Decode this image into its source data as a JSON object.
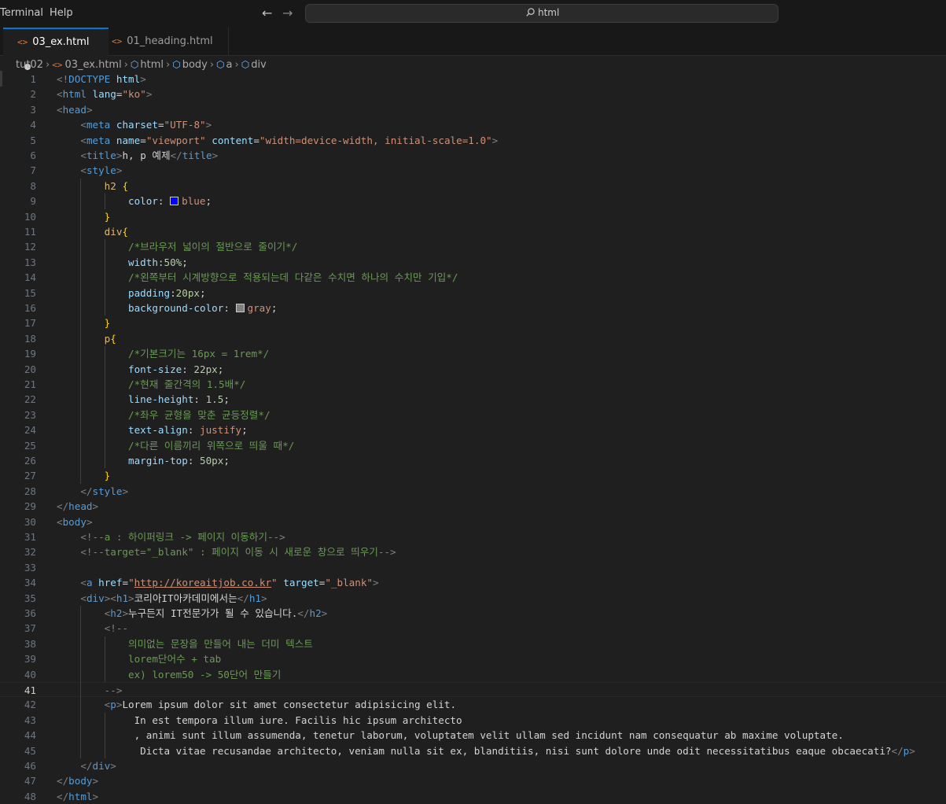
{
  "menu": {
    "terminal": "Terminal",
    "help": "Help"
  },
  "search": {
    "text": "html"
  },
  "tabs": [
    {
      "label": "03_ex.html",
      "active": true,
      "dirty": true
    },
    {
      "label": "01_heading.html",
      "active": false
    }
  ],
  "breadcrumb": [
    "tut02",
    "03_ex.html",
    "html",
    "body",
    "a",
    "div"
  ],
  "colors": {
    "tag": "#569cd6",
    "attr": "#9cdcfe",
    "string": "#ce9178",
    "comment": "#6a9955",
    "accent": "#0078d4"
  },
  "current_line": 41,
  "lines": [
    "<!DOCTYPE html>",
    "<html lang=\"ko\">",
    "<head>",
    "    <meta charset=\"UTF-8\">",
    "    <meta name=\"viewport\" content=\"width=device-width, initial-scale=1.0\">",
    "    <title>h, p 예제</title>",
    "    <style>",
    "        h2 {",
    "            color: blue;",
    "        }",
    "        div{",
    "            /*브라우저 넓이의 절반으로 줄이기*/",
    "            width:50%;",
    "            /*왼쪽부터 시계방향으로 적용되는데 다같은 수치면 하나의 수치만 기입*/",
    "            padding:20px;",
    "            background-color: gray;",
    "        }",
    "        p{",
    "            /*기본크기는 16px = 1rem*/",
    "            font-size: 22px;",
    "            /*현재 줄간격의 1.5배*/",
    "            line-height: 1.5;",
    "            /*좌우 균형을 맞춘 균등정렬*/",
    "            text-align: justify;",
    "            /*다른 이름끼리 위쪽으로 띄울 때*/",
    "            margin-top: 50px;",
    "        }",
    "    </style>",
    "</head>",
    "<body>",
    "    <!--a : 하이퍼링크 -> 페이지 이동하기-->",
    "    <!--target=\"_blank\" : 페이지 이동 시 새로운 창으로 띄우기-->",
    "",
    "    <a href=\"http://koreaitjob.co.kr\" target=\"_blank\">",
    "    <div><h1>코리아IT아카데미에서는</h1>",
    "        <h2>누구든지 IT전문가가 될 수 있습니다.</h2>",
    "        <!--",
    "            의미없는 문장을 만들어 내는 더미 텍스트",
    "            lorem단어수 + tab",
    "            ex) lorem50 -> 50단어 만들기",
    "        -->",
    "        <p>Lorem ipsum dolor sit amet consectetur adipisicing elit.",
    "             In est tempora illum iure. Facilis hic ipsum architecto",
    "             , animi sunt illum assumenda, tenetur laborum, voluptatem velit ullam sed incidunt nam consequatur ab maxime voluptate.",
    "              Dicta vitae recusandae architecto, veniam nulla sit ex, blanditiis, nisi sunt dolore unde odit necessitatibus eaque obcaecati?</p>",
    "    </div>",
    "</body>",
    "</html>"
  ]
}
